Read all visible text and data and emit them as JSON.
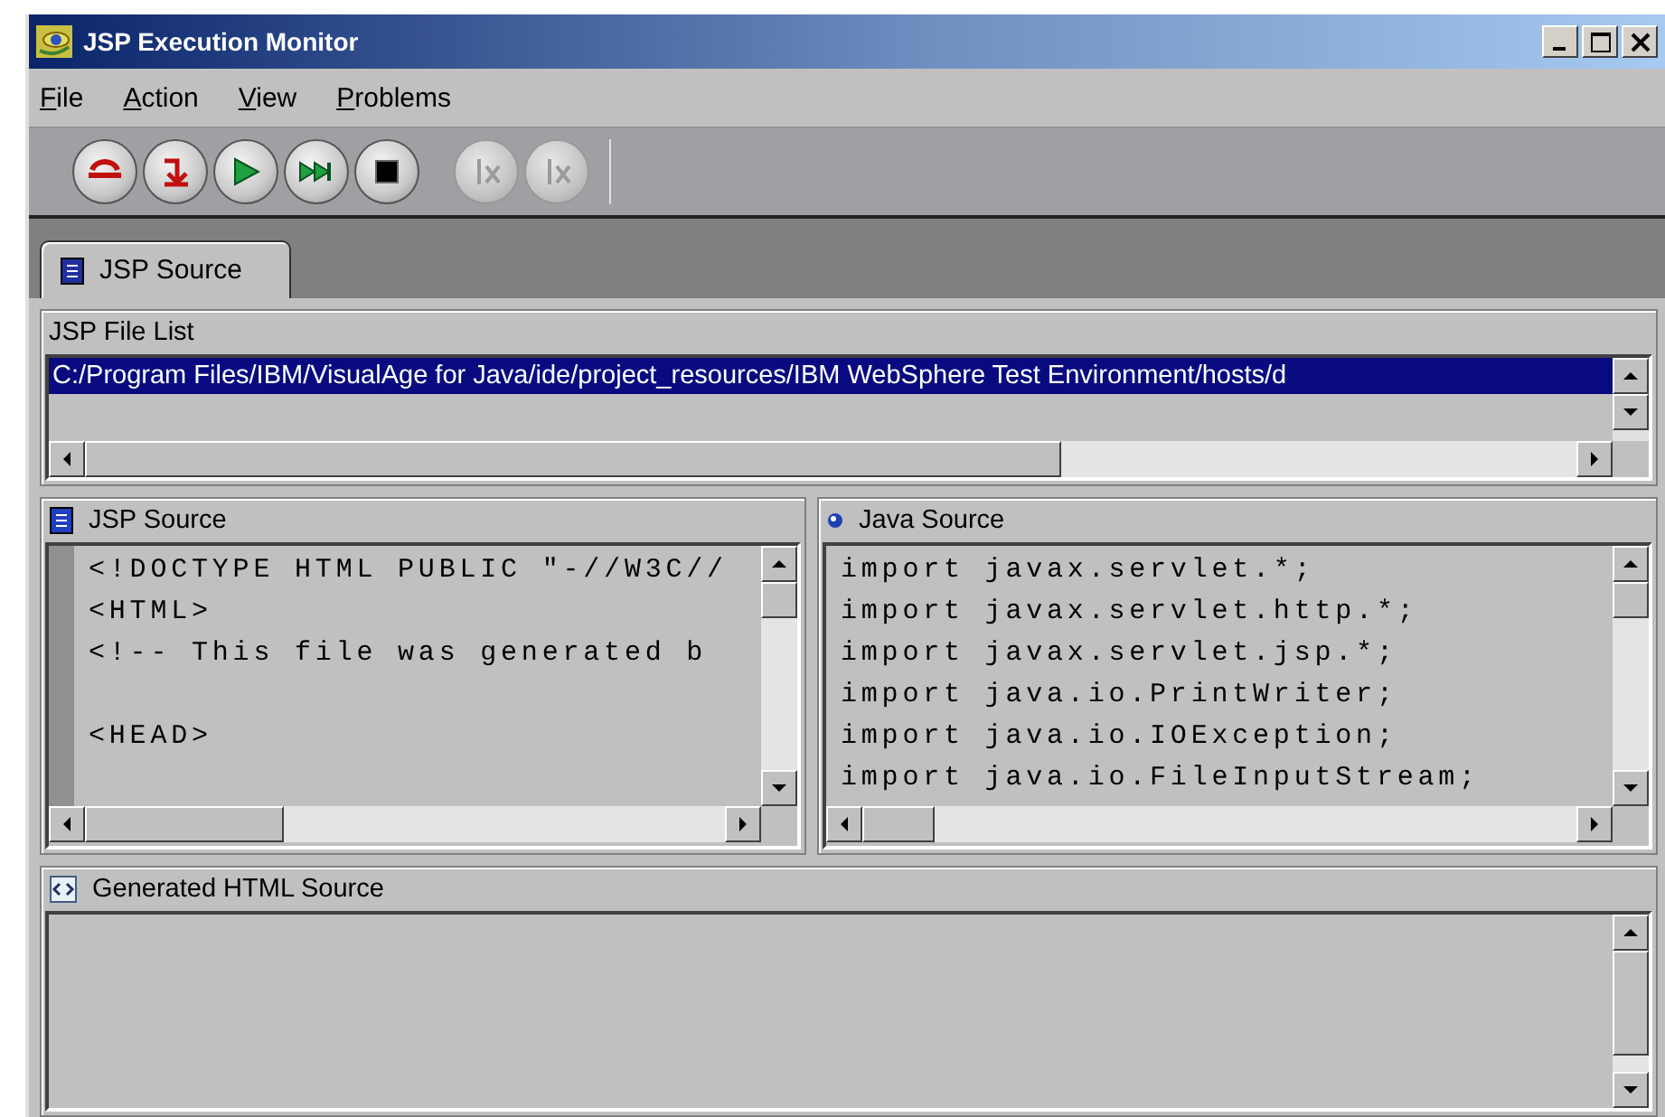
{
  "window": {
    "title": "JSP Execution Monitor"
  },
  "menu": [
    {
      "label": "File"
    },
    {
      "label": "Action"
    },
    {
      "label": "View"
    },
    {
      "label": "Problems"
    }
  ],
  "toolbar": {
    "buttons": [
      {
        "kind": "restart",
        "disabled": false
      },
      {
        "kind": "step",
        "disabled": false
      },
      {
        "kind": "run",
        "disabled": false
      },
      {
        "kind": "fastforward",
        "disabled": false
      },
      {
        "kind": "stop",
        "disabled": false
      },
      {
        "kind": "fx",
        "disabled": true
      },
      {
        "kind": "fx",
        "disabled": true
      }
    ]
  },
  "tabs": [
    {
      "label": "JSP Source",
      "selected": true
    }
  ],
  "file_list": {
    "title": "JSP File List",
    "rows": [
      {
        "path": "C:/Program Files/IBM/VisualAge for Java/ide/project_resources/IBM WebSphere Test Environment/hosts/d",
        "selected": true
      }
    ]
  },
  "jsp_source": {
    "title": "JSP Source",
    "lines": [
      {
        "text": "<!DOCTYPE HTML PUBLIC \"-//W3C//",
        "gap_before": false
      },
      {
        "text": "<HTML>",
        "gap_before": false
      },
      {
        "text": "<!-- This file was generated b",
        "gap_before": false
      },
      {
        "text": "<HEAD>",
        "gap_before": true
      }
    ]
  },
  "java_source": {
    "title": "Java Source",
    "lines": [
      {
        "text": "import javax.servlet.*;",
        "gap_before": false
      },
      {
        "text": "import javax.servlet.http.*;",
        "gap_before": false
      },
      {
        "text": "import javax.servlet.jsp.*;",
        "gap_before": false
      },
      {
        "text": "import java.io.PrintWriter;",
        "gap_before": false
      },
      {
        "text": "import java.io.IOException;",
        "gap_before": false
      },
      {
        "text": "import java.io.FileInputStream;",
        "gap_before": false
      }
    ]
  },
  "generated_html": {
    "title": "Generated HTML Source"
  }
}
